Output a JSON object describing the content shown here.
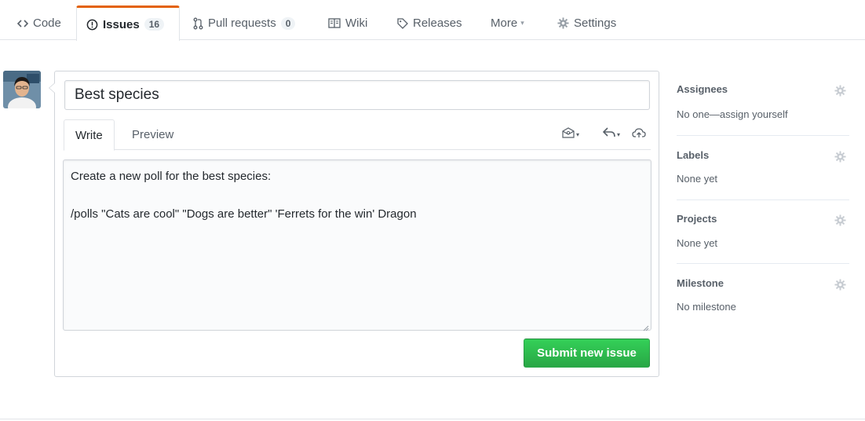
{
  "nav": {
    "code": "Code",
    "issues": "Issues",
    "issues_count": "16",
    "pull_requests": "Pull requests",
    "pull_requests_count": "0",
    "wiki": "Wiki",
    "releases": "Releases",
    "more": "More",
    "settings": "Settings"
  },
  "form": {
    "title_value": "Best species",
    "tabs": {
      "write": "Write",
      "preview": "Preview"
    },
    "body_line_1": "Create a new poll for the best species:",
    "body_line_2": "/polls \"Cats are cool\" \"Dogs are better\" 'Ferrets for the win' Dragon",
    "submit_label": "Submit new issue"
  },
  "sidebar": {
    "assignees": {
      "heading": "Assignees",
      "value": "No one—assign yourself"
    },
    "labels": {
      "heading": "Labels",
      "value": "None yet"
    },
    "projects": {
      "heading": "Projects",
      "value": "None yet"
    },
    "milestone": {
      "heading": "Milestone",
      "value": "No milestone"
    }
  },
  "colors": {
    "accent_tab": "#e36209",
    "submit_green": "#2cbe4e",
    "text_muted": "#586069",
    "border": "#d1d5da"
  },
  "icons": [
    "code-icon",
    "issue-opened-icon",
    "git-pull-request-icon",
    "book-icon",
    "tag-icon",
    "gear-icon",
    "mention-icon",
    "reply-icon",
    "cloud-upload-icon",
    "resize-grip-icon"
  ]
}
